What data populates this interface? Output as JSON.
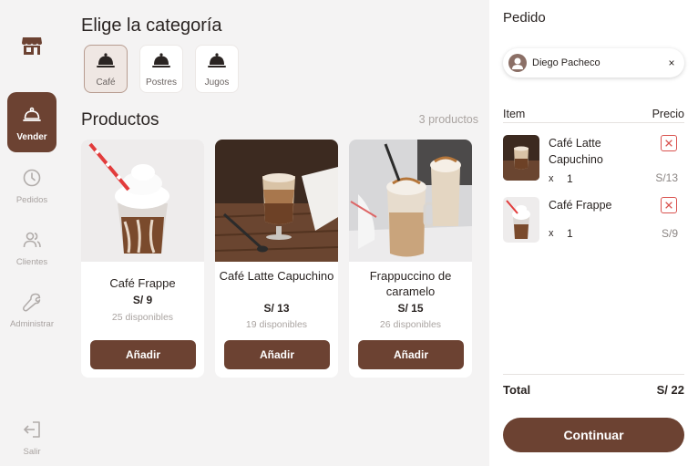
{
  "sidebar": {
    "items": [
      {
        "label": "Vender",
        "icon": "cloche-icon",
        "active": true
      },
      {
        "label": "Pedidos",
        "icon": "clock-icon"
      },
      {
        "label": "Clientes",
        "icon": "users-icon"
      },
      {
        "label": "Administrar",
        "icon": "wrench-icon"
      }
    ],
    "logout_label": "Salir",
    "logo_icon": "store-icon"
  },
  "categories": {
    "title": "Elige la categoría",
    "items": [
      {
        "label": "Café",
        "active": true
      },
      {
        "label": "Postres"
      },
      {
        "label": "Jugos"
      }
    ]
  },
  "products": {
    "title": "Productos",
    "count": "3 productos",
    "items": [
      {
        "name": "Café Frappe",
        "price": "S/ 9",
        "stock": "25 disponibles",
        "add_label": "Añadir"
      },
      {
        "name": "Café Latte Capuchino",
        "price": "S/ 13",
        "stock": "19 disponibles",
        "add_label": "Añadir"
      },
      {
        "name": "Frappuccino de caramelo",
        "price": "S/ 15",
        "stock": "26 disponibles",
        "add_label": "Añadir"
      }
    ]
  },
  "order": {
    "title": "Pedido",
    "client": "Diego Pacheco",
    "close_symbol": "×",
    "col_item": "Item",
    "col_price": "Precio",
    "items": [
      {
        "name": "Café Latte Capuchino",
        "qty_prefix": "x",
        "qty": "1",
        "price": "S/13"
      },
      {
        "name": "Café Frappe",
        "qty_prefix": "x",
        "qty": "1",
        "price": "S/9"
      }
    ],
    "total_label": "Total",
    "total_value": "S/ 22",
    "continue_label": "Continuar"
  },
  "colors": {
    "accent": "#6c4232",
    "background": "#f4f3f3",
    "remove": "#d9534f"
  }
}
